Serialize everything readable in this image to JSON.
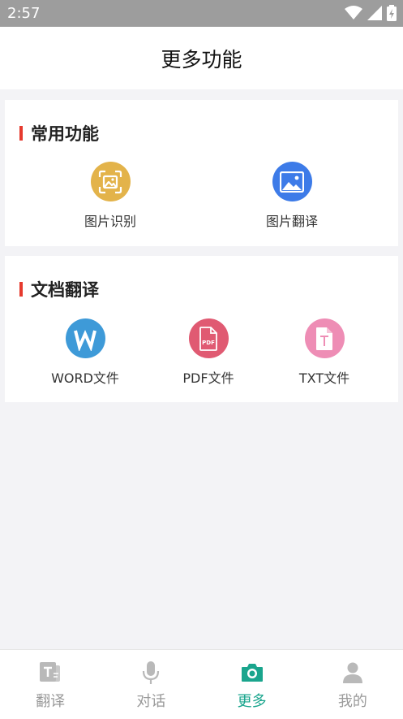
{
  "status_bar": {
    "time": "2:57"
  },
  "header": {
    "title": "更多功能"
  },
  "sections": {
    "common": {
      "title": "常用功能",
      "items": [
        {
          "label": "图片识别",
          "icon": "image-scan-icon",
          "color": "#e3b34a"
        },
        {
          "label": "图片翻译",
          "icon": "image-icon",
          "color": "#3d7be8"
        }
      ]
    },
    "documents": {
      "title": "文档翻译",
      "items": [
        {
          "label": "WORD文件",
          "icon": "word-icon",
          "color": "#3e9ad8"
        },
        {
          "label": "PDF文件",
          "icon": "pdf-icon",
          "color": "#e05a72"
        },
        {
          "label": "TXT文件",
          "icon": "txt-icon",
          "color": "#ee8db5"
        }
      ]
    }
  },
  "bottom_nav": {
    "items": [
      {
        "label": "翻译",
        "icon": "translate-icon",
        "active": false
      },
      {
        "label": "对话",
        "icon": "microphone-icon",
        "active": false
      },
      {
        "label": "更多",
        "icon": "camera-icon",
        "active": true
      },
      {
        "label": "我的",
        "icon": "person-icon",
        "active": false
      }
    ]
  },
  "colors": {
    "accent": "#1aa58d",
    "section_marker": "#e63a2e",
    "status_bar": "#9d9d9d",
    "background": "#f3f3f6"
  }
}
